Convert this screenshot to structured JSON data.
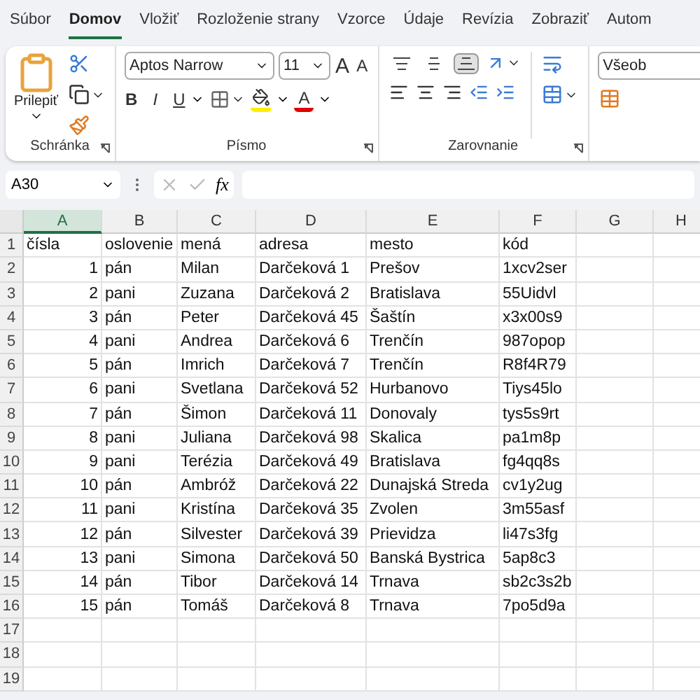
{
  "menu_tabs": [
    {
      "label": "Súbor",
      "selected": false
    },
    {
      "label": "Domov",
      "selected": true
    },
    {
      "label": "Vložiť",
      "selected": false
    },
    {
      "label": "Rozloženie strany",
      "selected": false
    },
    {
      "label": "Vzorce",
      "selected": false
    },
    {
      "label": "Údaje",
      "selected": false
    },
    {
      "label": "Revízia",
      "selected": false
    },
    {
      "label": "Zobraziť",
      "selected": false
    },
    {
      "label": "Autom",
      "selected": false
    }
  ],
  "ribbon": {
    "groups": [
      {
        "kind": "clipboard",
        "label": "Schránka",
        "paste_label": "Prilepiť"
      },
      {
        "kind": "font",
        "label": "Písmo",
        "font_name": "Aptos Narrow",
        "font_size": "11",
        "grow_label": "A",
        "shrink_label": "A",
        "bold_label": "B",
        "italic_label": "I",
        "underline_label": "U",
        "font_color_label": "A"
      },
      {
        "kind": "alignment",
        "label": "Zarovnanie",
        "vertical": [
          {
            "kind": "top",
            "selected": false
          },
          {
            "kind": "middle",
            "selected": false
          },
          {
            "kind": "bottom",
            "selected": true
          }
        ]
      },
      {
        "kind": "number",
        "format": "Všeob"
      }
    ]
  },
  "formula_bar": {
    "name_box": "A30",
    "fx_label": "fx"
  },
  "columns": [
    {
      "letter": "A",
      "selected": true
    },
    {
      "letter": "B",
      "selected": false
    },
    {
      "letter": "C",
      "selected": false
    },
    {
      "letter": "D",
      "selected": false
    },
    {
      "letter": "E",
      "selected": false
    },
    {
      "letter": "F",
      "selected": false
    },
    {
      "letter": "G",
      "selected": false
    },
    {
      "letter": "H",
      "selected": false
    }
  ],
  "rows": [
    {
      "number": "1",
      "kind": "header",
      "cells": [
        "čísla",
        "oslovenie",
        "mená",
        "adresa",
        "mesto",
        "kód"
      ]
    },
    {
      "number": "2",
      "kind": "data",
      "cells": [
        "1",
        "pán",
        "Milan",
        "Darčeková 1",
        "Prešov",
        "1xcv2ser"
      ]
    },
    {
      "number": "3",
      "kind": "data",
      "cells": [
        "2",
        "pani",
        "Zuzana",
        "Darčeková 2",
        "Bratislava",
        "55Uidvl"
      ]
    },
    {
      "number": "4",
      "kind": "data",
      "cells": [
        "3",
        "pán",
        "Peter",
        "Darčeková 45",
        "Šaštín",
        "x3x00s9"
      ]
    },
    {
      "number": "5",
      "kind": "data",
      "cells": [
        "4",
        "pani",
        "Andrea",
        "Darčeková 6",
        "Trenčín",
        "987opop"
      ]
    },
    {
      "number": "6",
      "kind": "data",
      "cells": [
        "5",
        "pán",
        "Imrich",
        "Darčeková 7",
        "Trenčín",
        "R8f4R79"
      ]
    },
    {
      "number": "7",
      "kind": "data",
      "cells": [
        "6",
        "pani",
        "Svetlana",
        "Darčeková 52",
        "Hurbanovo",
        "Tiys45lo"
      ]
    },
    {
      "number": "8",
      "kind": "data",
      "cells": [
        "7",
        "pán",
        "Šimon",
        "Darčeková 11",
        "Donovaly",
        "tys5s9rt"
      ]
    },
    {
      "number": "9",
      "kind": "data",
      "cells": [
        "8",
        "pani",
        "Juliana",
        "Darčeková 98",
        "Skalica",
        "pa1m8p"
      ]
    },
    {
      "number": "10",
      "kind": "data",
      "cells": [
        "9",
        "pani",
        "Terézia",
        "Darčeková 49",
        "Bratislava",
        "fg4qq8s"
      ]
    },
    {
      "number": "11",
      "kind": "data",
      "cells": [
        "10",
        "pán",
        "Ambróž",
        "Darčeková 22",
        "Dunajská Streda",
        "cv1y2ug"
      ]
    },
    {
      "number": "12",
      "kind": "data",
      "cells": [
        "11",
        "pani",
        "Kristína",
        "Darčeková 35",
        "Zvolen",
        "3m55asf"
      ]
    },
    {
      "number": "13",
      "kind": "data",
      "cells": [
        "12",
        "pán",
        "Silvester",
        "Darčeková 39",
        "Prievidza",
        "li47s3fg"
      ]
    },
    {
      "number": "14",
      "kind": "data",
      "cells": [
        "13",
        "pani",
        "Simona",
        "Darčeková 50",
        "Banská Bystrica",
        "5ap8c3"
      ]
    },
    {
      "number": "15",
      "kind": "data",
      "cells": [
        "14",
        "pán",
        "Tibor",
        "Darčeková 14",
        "Trnava",
        "sb2c3s2b"
      ]
    },
    {
      "number": "16",
      "kind": "data",
      "cells": [
        "15",
        "pán",
        "Tomáš",
        "Darčeková 8",
        "Trnava",
        "7po5d9a"
      ]
    },
    {
      "number": "17",
      "kind": "empty"
    },
    {
      "number": "18",
      "kind": "empty"
    },
    {
      "number": "19",
      "kind": "empty"
    }
  ]
}
